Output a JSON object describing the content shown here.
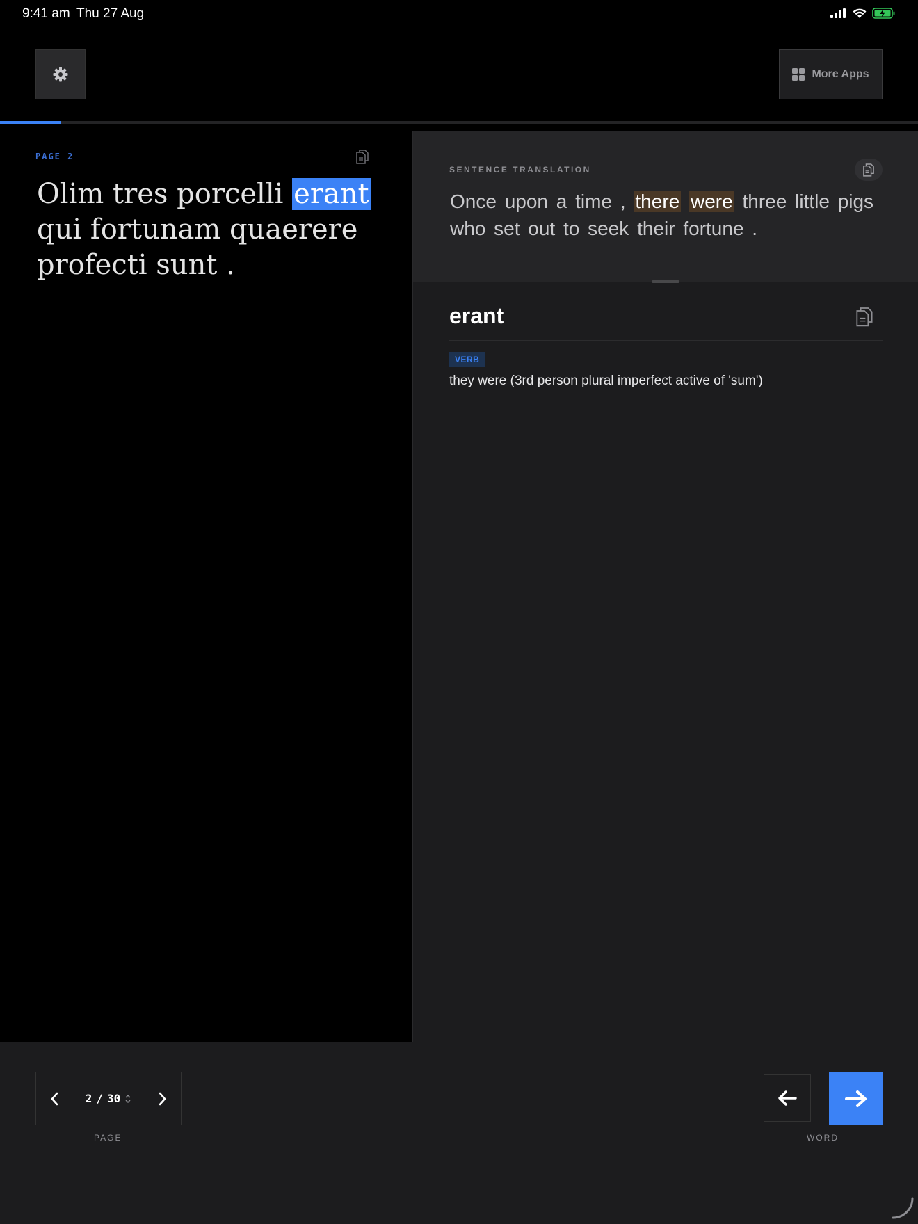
{
  "status_bar": {
    "time": "9:41 am",
    "date": "Thu 27 Aug",
    "icons": [
      "signal-icon",
      "wifi-icon",
      "battery-charging-icon"
    ]
  },
  "toolbar": {
    "settings_icon": "gear-icon",
    "more_apps_icon": "grid-icon",
    "more_apps_label": "More Apps"
  },
  "progress": {
    "fraction": 0.066,
    "color": "#3b82f6"
  },
  "reader": {
    "page_label": "PAGE 2",
    "latin_words": [
      {
        "text": "Olim",
        "selected": false
      },
      {
        "text": "tres",
        "selected": false
      },
      {
        "text": "porcelli",
        "selected": false
      },
      {
        "text": "erant",
        "selected": true
      },
      {
        "text": "qui",
        "selected": false
      },
      {
        "text": "fortunam",
        "selected": false
      },
      {
        "text": "quaerere",
        "selected": false
      },
      {
        "text": "profecti",
        "selected": false
      },
      {
        "text": "sunt",
        "selected": false
      },
      {
        "text": ".",
        "selected": false
      }
    ]
  },
  "translation": {
    "label": "SENTENCE TRANSLATION",
    "words": [
      {
        "text": "Once",
        "hl": false
      },
      {
        "text": "upon",
        "hl": false
      },
      {
        "text": "a",
        "hl": false
      },
      {
        "text": "time",
        "hl": false
      },
      {
        "text": ",",
        "hl": false
      },
      {
        "text": "there",
        "hl": true
      },
      {
        "text": "were",
        "hl": true
      },
      {
        "text": "three",
        "hl": false
      },
      {
        "text": "little",
        "hl": false
      },
      {
        "text": "pigs",
        "hl": false
      },
      {
        "text": "who",
        "hl": false
      },
      {
        "text": "set",
        "hl": false
      },
      {
        "text": "out",
        "hl": false
      },
      {
        "text": "to",
        "hl": false
      },
      {
        "text": "seek",
        "hl": false
      },
      {
        "text": "their",
        "hl": false
      },
      {
        "text": "fortune",
        "hl": false
      },
      {
        "text": ".",
        "hl": false
      }
    ]
  },
  "word_detail": {
    "headword": "erant",
    "part_of_speech": "VERB",
    "definition": "they were (3rd person plural imperfect active of 'sum')"
  },
  "bottom": {
    "page_current": "2",
    "page_separator": "/",
    "page_total": "30",
    "page_caption": "PAGE",
    "word_caption": "WORD"
  },
  "colors": {
    "accent": "#3b82f6",
    "highlight": "#4a3826",
    "pane_bg": "#1c1c1e"
  }
}
